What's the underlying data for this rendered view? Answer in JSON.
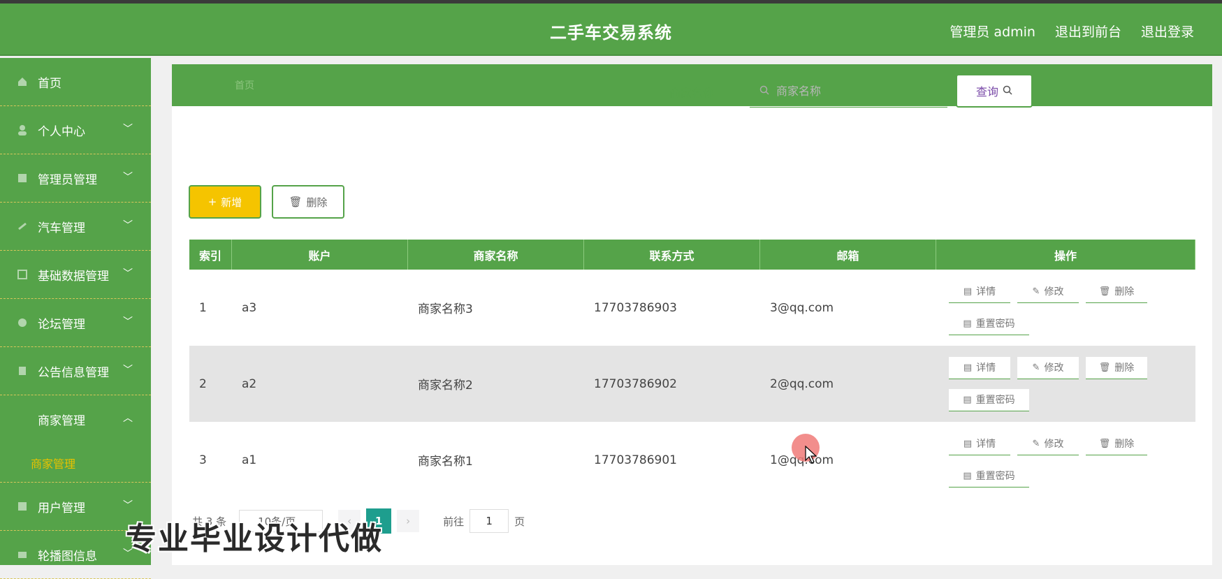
{
  "header": {
    "title": "二手车交易系统",
    "admin": "管理员 admin",
    "back_front": "退出到前台",
    "logout": "退出登录"
  },
  "sidebar": {
    "items": [
      {
        "label": "首页"
      },
      {
        "label": "个人中心"
      },
      {
        "label": "管理员管理"
      },
      {
        "label": "汽车管理"
      },
      {
        "label": "基础数据管理"
      },
      {
        "label": "论坛管理"
      },
      {
        "label": "公告信息管理"
      },
      {
        "label": "商家管理"
      },
      {
        "label": "用户管理"
      },
      {
        "label": "轮播图信息"
      }
    ],
    "sub_active": "商家管理"
  },
  "breadcrumb": "首页",
  "search": {
    "label": "商家名称",
    "placeholder": "商家名称",
    "button": "查询"
  },
  "actions": {
    "add": "新增",
    "delete": "删除"
  },
  "table": {
    "headers": [
      "索引",
      "账户",
      "商家名称",
      "联系方式",
      "邮箱",
      "操作"
    ],
    "rows": [
      {
        "index": "1",
        "account": "a3",
        "name": "商家名称3",
        "phone": "17703786903",
        "email": "3@qq.com"
      },
      {
        "index": "2",
        "account": "a2",
        "name": "商家名称2",
        "phone": "17703786902",
        "email": "2@qq.com"
      },
      {
        "index": "3",
        "account": "a1",
        "name": "商家名称1",
        "phone": "17703786901",
        "email": "1@qq.com"
      }
    ],
    "ops": {
      "detail": "详情",
      "edit": "修改",
      "remove": "删除",
      "reset": "重置密码"
    }
  },
  "pagination": {
    "total": "共 3 条",
    "page_size": "10条/页",
    "current": "1",
    "goto_label": "前往",
    "goto_value": "1",
    "page_unit": "页"
  },
  "watermark": "专业毕业设计代做",
  "colors": {
    "primary": "#55a349",
    "add_button": "#f5c400",
    "active_sub": "#e8c200",
    "pager_active": "#1e9e8e"
  }
}
